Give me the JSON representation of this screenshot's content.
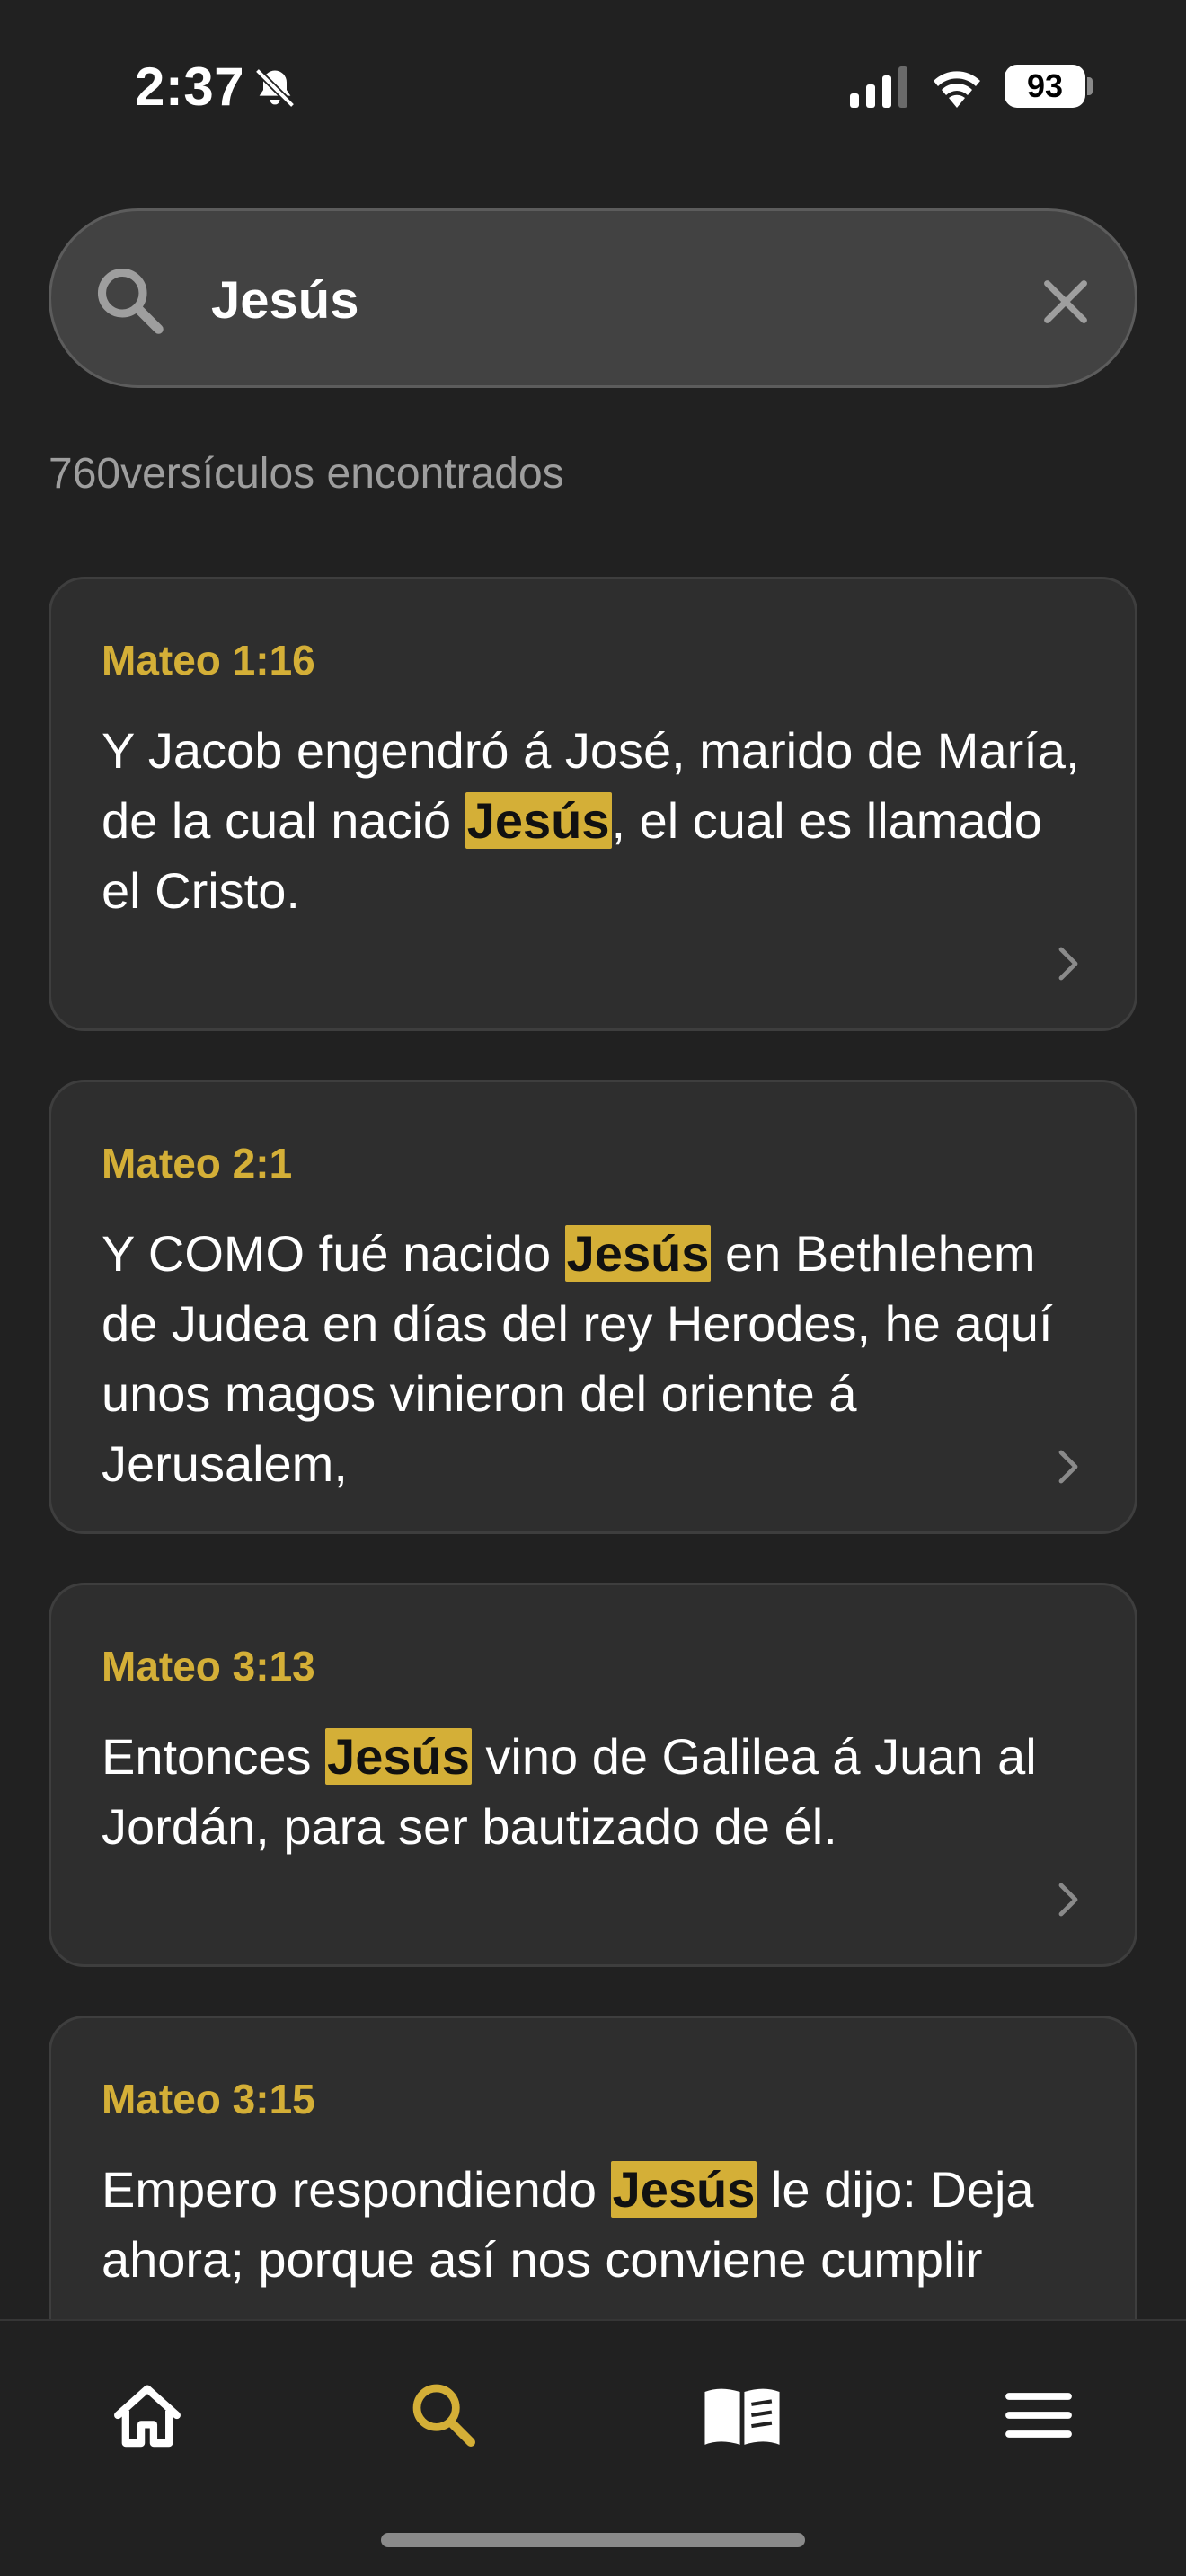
{
  "status_bar": {
    "time": "2:37",
    "battery": "93",
    "icons": [
      "bell-slash-icon",
      "cellular-signal-icon",
      "wifi-icon",
      "battery-icon"
    ]
  },
  "search": {
    "value": "Jesús",
    "placeholder": "",
    "icon": "search-icon",
    "clear_icon": "close-icon"
  },
  "result_count": "760versículos encontrados",
  "results": [
    {
      "reference": "Mateo 1:16",
      "before": "Y Jacob engendró á José, marido de María, de la cual nació ",
      "match": "Jesús",
      "after": ", el cual es llamado el Cristo."
    },
    {
      "reference": "Mateo 2:1",
      "before": "Y COMO fué nacido ",
      "match": "Jesús",
      "after": " en Bethlehem de Judea en días del rey Herodes, he aquí unos magos vinieron del oriente á Jerusalem,"
    },
    {
      "reference": "Mateo 3:13",
      "before": "Entonces ",
      "match": "Jesús",
      "after": " vino de Galilea á Juan al Jordán, para ser bautizado de él."
    },
    {
      "reference": "Mateo 3:15",
      "before": "Empero respondiendo ",
      "match": "Jesús",
      "after": " le dijo: Deja ahora; porque así nos conviene cumplir"
    }
  ],
  "bottom_nav": [
    {
      "icon": "home-icon",
      "active": false
    },
    {
      "icon": "search-icon",
      "active": true
    },
    {
      "icon": "book-icon",
      "active": false
    },
    {
      "icon": "menu-icon",
      "active": false
    }
  ],
  "colors": {
    "background": "#212121",
    "card": "#2e2e2e",
    "accent": "#d4af37",
    "text": "#ffffff",
    "muted": "#9e9e9e"
  }
}
